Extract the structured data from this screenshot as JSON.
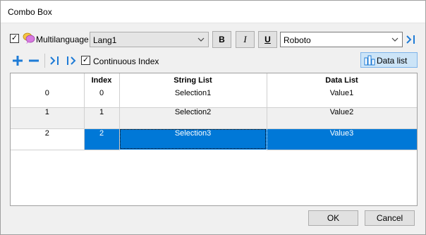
{
  "window": {
    "title": "Combo Box"
  },
  "toolbar": {
    "multilanguage_label": "Multilanguage",
    "multilanguage_checked": true,
    "language_value": "Lang1",
    "bold_label": "B",
    "italic_label": "I",
    "underline_label": "U",
    "font_value": "Roboto"
  },
  "list_toolbar": {
    "continuous_index_label": "Continuous Index",
    "continuous_index_checked": true,
    "data_list_label": "Data list"
  },
  "grid": {
    "columns": [
      "",
      "Index",
      "String List",
      "Data List"
    ],
    "rows": [
      {
        "row": "0",
        "index": "0",
        "string": "Selection1",
        "data": "Value1"
      },
      {
        "row": "1",
        "index": "1",
        "string": "Selection2",
        "data": "Value2"
      },
      {
        "row": "2",
        "index": "2",
        "string": "Selection3",
        "data": "Value3"
      }
    ]
  },
  "buttons": {
    "ok": "OK",
    "cancel": "Cancel"
  },
  "colors": {
    "accent": "#0078d7",
    "icon_blue": "#1e7bd6",
    "selected_toggle": "#cce4f7"
  }
}
